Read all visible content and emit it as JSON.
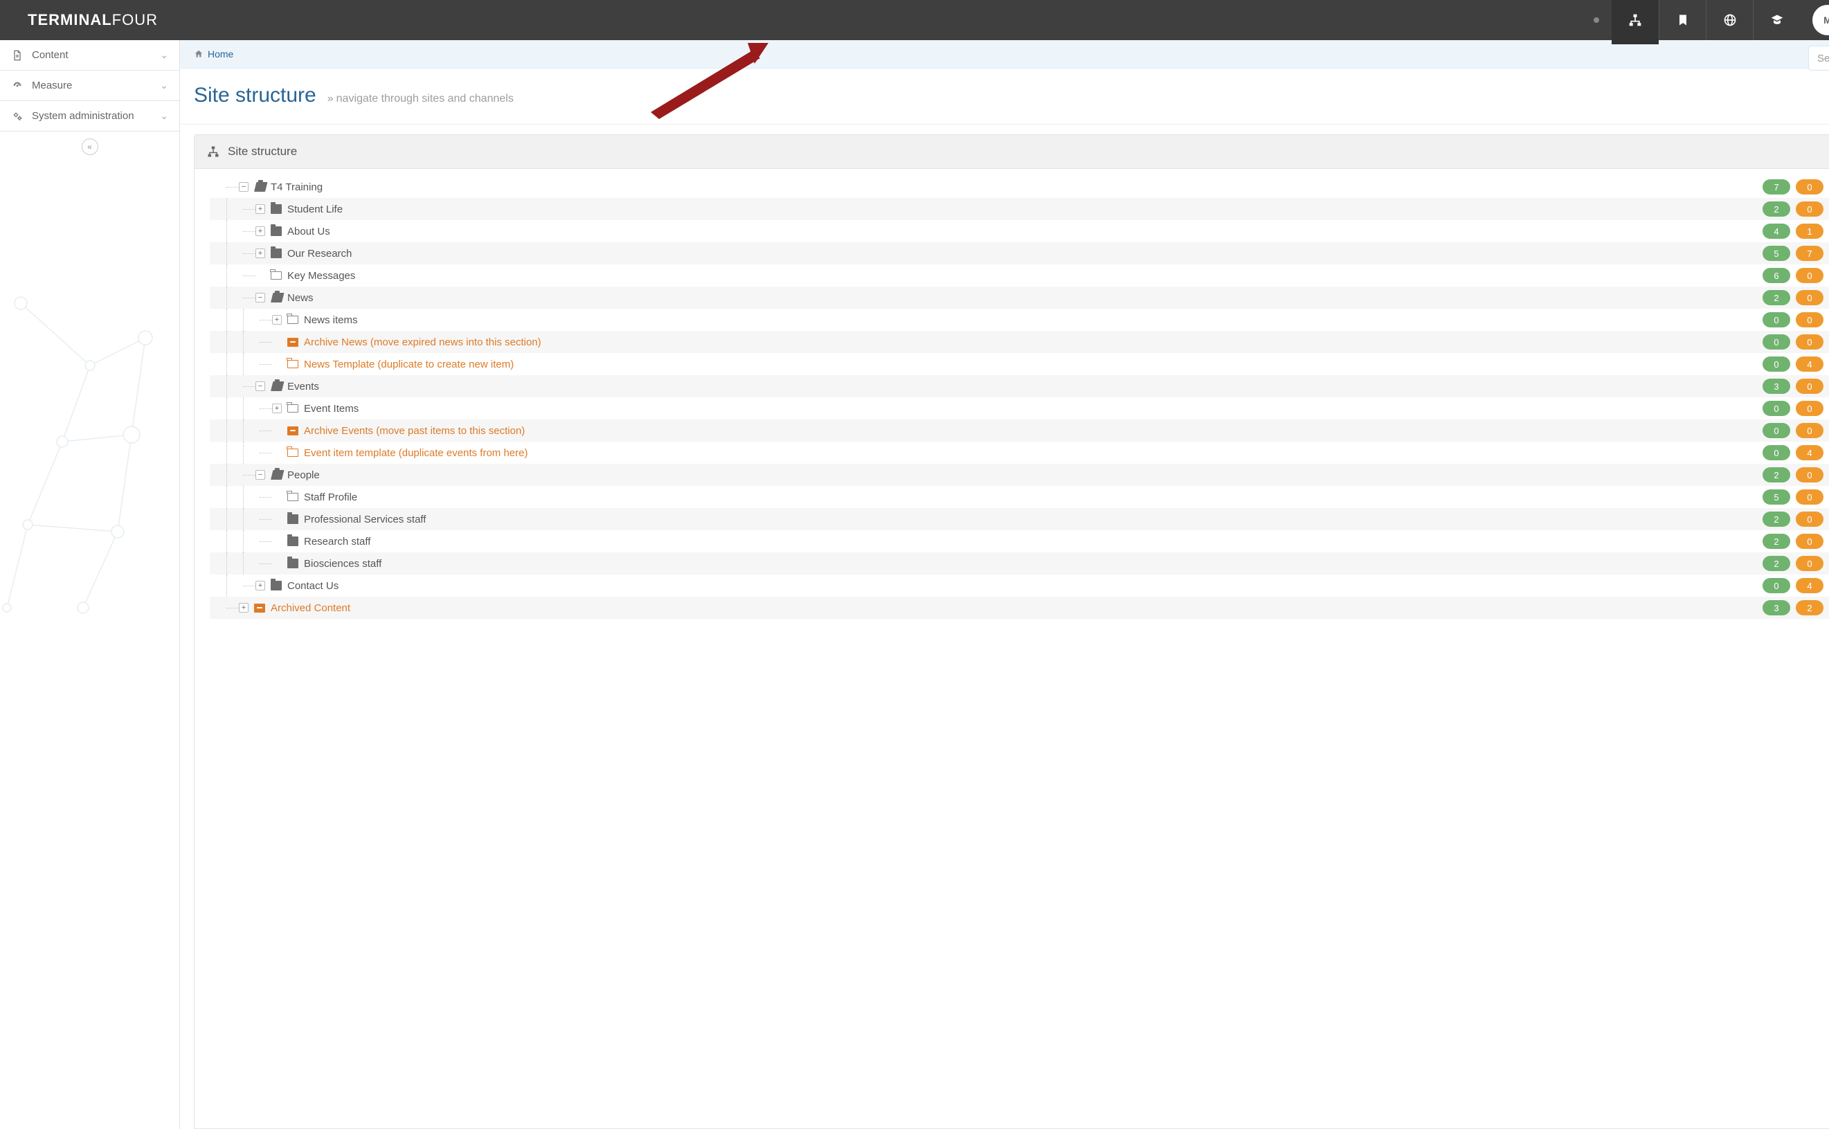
{
  "brand": {
    "part1": "TERMINAL",
    "part2": "FOUR"
  },
  "avatar_initial": "M",
  "search_placeholder": "Se",
  "sidebar": {
    "items": [
      {
        "label": "Content",
        "icon": "file"
      },
      {
        "label": "Measure",
        "icon": "dashboard"
      },
      {
        "label": "System administration",
        "icon": "gears"
      }
    ]
  },
  "breadcrumb": {
    "home": "Home"
  },
  "title": "Site structure",
  "subtitle": "navigate through sites and channels",
  "panel_title": "Site structure",
  "tree": [
    {
      "depth": 0,
      "toggle": "minus",
      "icon": "folder-open",
      "orange": false,
      "label": "T4 Training",
      "g": 7,
      "o": 0
    },
    {
      "depth": 1,
      "toggle": "plus",
      "icon": "folder-closed",
      "orange": false,
      "label": "Student Life",
      "g": 2,
      "o": 0
    },
    {
      "depth": 1,
      "toggle": "plus",
      "icon": "folder-closed",
      "orange": false,
      "label": "About Us",
      "g": 4,
      "o": 1
    },
    {
      "depth": 1,
      "toggle": "plus",
      "icon": "folder-closed",
      "orange": false,
      "label": "Our Research",
      "g": 5,
      "o": 7
    },
    {
      "depth": 1,
      "toggle": "none",
      "icon": "folder-outline",
      "orange": false,
      "label": "Key Messages",
      "g": 6,
      "o": 0
    },
    {
      "depth": 1,
      "toggle": "minus",
      "icon": "folder-open",
      "orange": false,
      "label": "News",
      "g": 2,
      "o": 0
    },
    {
      "depth": 2,
      "toggle": "plus",
      "icon": "folder-outline",
      "orange": false,
      "label": "News items",
      "g": 0,
      "o": 0
    },
    {
      "depth": 2,
      "toggle": "none",
      "icon": "archive",
      "orange": true,
      "label": "Archive News (move expired news into this section)",
      "g": 0,
      "o": 0
    },
    {
      "depth": 2,
      "toggle": "none",
      "icon": "folder-outline",
      "orange": true,
      "label": "News Template (duplicate to create new item)",
      "g": 0,
      "o": 4
    },
    {
      "depth": 1,
      "toggle": "minus",
      "icon": "folder-open",
      "orange": false,
      "label": "Events",
      "g": 3,
      "o": 0
    },
    {
      "depth": 2,
      "toggle": "plus",
      "icon": "folder-outline",
      "orange": false,
      "label": "Event Items",
      "g": 0,
      "o": 0
    },
    {
      "depth": 2,
      "toggle": "none",
      "icon": "archive",
      "orange": true,
      "label": "Archive Events (move past items to this section)",
      "g": 0,
      "o": 0
    },
    {
      "depth": 2,
      "toggle": "none",
      "icon": "folder-outline",
      "orange": true,
      "label": "Event item template (duplicate events from here)",
      "g": 0,
      "o": 4
    },
    {
      "depth": 1,
      "toggle": "minus",
      "icon": "folder-open",
      "orange": false,
      "label": "People",
      "g": 2,
      "o": 0
    },
    {
      "depth": 2,
      "toggle": "none",
      "icon": "folder-outline",
      "orange": false,
      "label": "Staff Profile",
      "g": 5,
      "o": 0
    },
    {
      "depth": 2,
      "toggle": "none",
      "icon": "folder-closed",
      "orange": false,
      "label": "Professional Services staff",
      "g": 2,
      "o": 0
    },
    {
      "depth": 2,
      "toggle": "none",
      "icon": "folder-closed",
      "orange": false,
      "label": "Research staff",
      "g": 2,
      "o": 0
    },
    {
      "depth": 2,
      "toggle": "none",
      "icon": "folder-closed",
      "orange": false,
      "label": "Biosciences staff",
      "g": 2,
      "o": 0
    },
    {
      "depth": 1,
      "toggle": "plus",
      "icon": "folder-closed",
      "orange": false,
      "label": "Contact Us",
      "g": 0,
      "o": 4
    },
    {
      "depth": 0,
      "toggle": "plus",
      "icon": "archive",
      "orange": true,
      "label": "Archived Content",
      "g": 3,
      "o": 2
    }
  ]
}
